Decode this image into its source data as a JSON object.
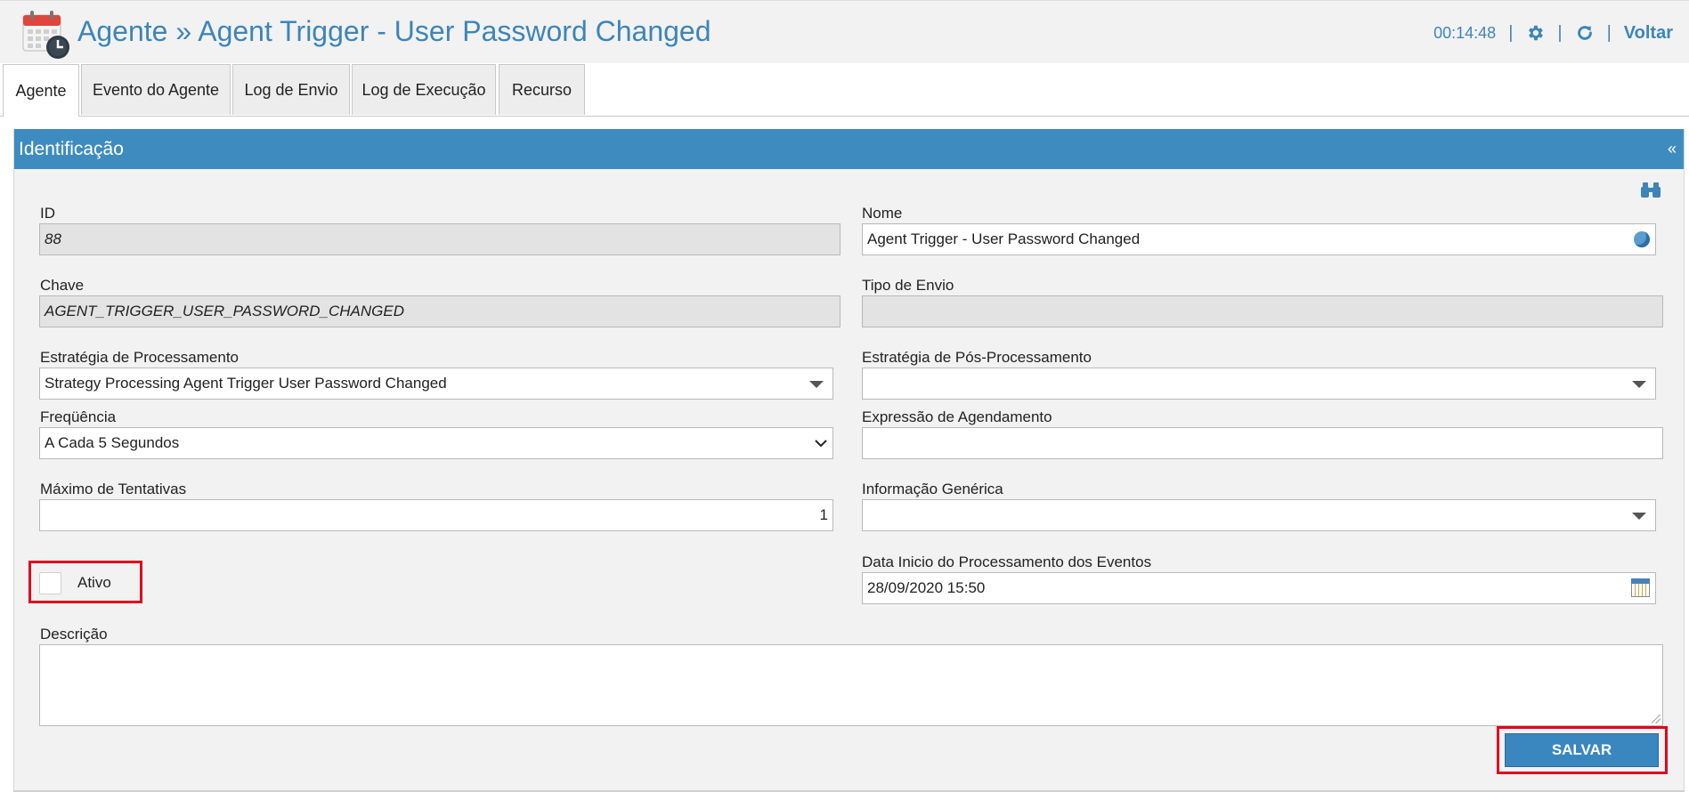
{
  "header": {
    "title": "Agente » Agent Trigger - User Password Changed",
    "time": "00:14:48",
    "separator": "|",
    "back_label": "Voltar",
    "accent_color": "#3d85b8"
  },
  "tabs": [
    {
      "label": "Agente",
      "active": true
    },
    {
      "label": "Evento do Agente",
      "active": false
    },
    {
      "label": "Log de Envio",
      "active": false
    },
    {
      "label": "Log de Execução",
      "active": false
    },
    {
      "label": "Recurso",
      "active": false
    }
  ],
  "panel": {
    "title": "Identificação",
    "collapse_glyph": "«",
    "header_color": "#3e8cbf"
  },
  "form": {
    "id": {
      "label": "ID",
      "value": "88"
    },
    "nome": {
      "label": "Nome",
      "value": "Agent Trigger - User Password Changed"
    },
    "chave": {
      "label": "Chave",
      "value": "AGENT_TRIGGER_USER_PASSWORD_CHANGED"
    },
    "tipo_envio": {
      "label": "Tipo de Envio",
      "value": ""
    },
    "estrategia_processamento": {
      "label": "Estratégia de Processamento",
      "value": "Strategy Processing Agent Trigger User Password Changed"
    },
    "estrategia_pos": {
      "label": "Estratégia de Pós-Processamento",
      "value": ""
    },
    "frequencia": {
      "label": "Freqüência",
      "value": "A Cada 5 Segundos"
    },
    "expressao": {
      "label": "Expressão de Agendamento",
      "value": ""
    },
    "max_tentativas": {
      "label": "Máximo de Tentativas",
      "value": "1"
    },
    "info_generica": {
      "label": "Informação Genérica",
      "value": ""
    },
    "ativo": {
      "label": "Ativo",
      "checked": false
    },
    "data_inicio": {
      "label": "Data Inicio do Processamento dos Eventos",
      "value": "28/09/2020 15:50"
    },
    "descricao": {
      "label": "Descrição",
      "value": ""
    }
  },
  "actions": {
    "save_label": "SALVAR",
    "highlight_color": "#e3001b"
  },
  "icons": [
    "calendar-clock-icon",
    "gear-icon",
    "refresh-icon",
    "binoculars-icon",
    "globe-icon",
    "calendar-icon"
  ]
}
